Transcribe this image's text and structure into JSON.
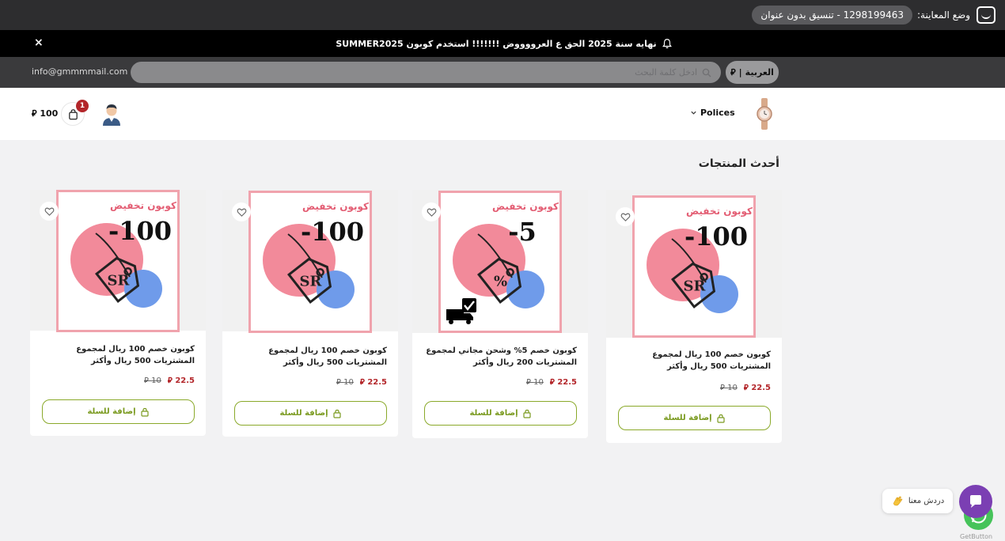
{
  "preview_bar": {
    "label": "وضع المعاينة:",
    "store_name": "1298199463 - تنسيق بدون عنوان"
  },
  "announcement": {
    "text": "نهايه سنة 2025 الحق ع العرووووض !!!!!!! استخدم كوبون SUMMER2025",
    "close_label": "×"
  },
  "topbar": {
    "email": "info@gmmmmail.com",
    "search_placeholder": "ادخل كلمة البحث",
    "language": "العربية",
    "currency_symbol": "⃁"
  },
  "header": {
    "nav_item": "Polices",
    "cart_count": "1",
    "cart_total": "100 ⃁"
  },
  "section": {
    "title": "أحدث المنتجات"
  },
  "products": [
    {
      "title": "كوبون خصم 100 ريال لمجموع المشتريات 500 ريال وأكثر",
      "price": "22.5 ⃁",
      "old_price": "10 ⃁",
      "button": "إضافة للسلة",
      "image": {
        "heading": "كوبون تخفيض",
        "value": "-100",
        "unit": "SR",
        "truck": false
      }
    },
    {
      "title": "كوبون خصم 5% وشحن مجاني لمجموع المشتريات 200 ريال وأكثر",
      "price": "22.5 ⃁",
      "old_price": "10 ⃁",
      "button": "إضافة للسلة",
      "image": {
        "heading": "كوبون تخفيض",
        "value": "-5",
        "unit": "%",
        "truck": true
      }
    },
    {
      "title": "كوبون خصم 100 ريال لمجموع المشتريات 500 ريال وأكثر",
      "price": "22.5 ⃁",
      "old_price": "10 ⃁",
      "button": "إضافة للسلة",
      "image": {
        "heading": "كوبون تخفيض",
        "value": "-100",
        "unit": "SR",
        "truck": false
      }
    },
    {
      "title": "كوبون خصم 100 ريال لمجموع المشتريات 500 ريال وأكثر",
      "price": "22.5 ⃁",
      "old_price": "10 ⃁",
      "button": "إضافة للسلة",
      "image": {
        "heading": "كوبون تخفيض",
        "value": "-100",
        "unit": "SR",
        "truck": false
      }
    }
  ],
  "chat": {
    "label": "دردش معنا",
    "powered_by": "GetButton"
  },
  "colors": {
    "accent_green": "#7a9a1f",
    "price_red": "#b3262a",
    "coupon_pink": "#f28a9a",
    "coupon_blue": "#6f9bea",
    "chat_purple": "#7b3fb3",
    "whatsapp_green": "#46c35a"
  }
}
